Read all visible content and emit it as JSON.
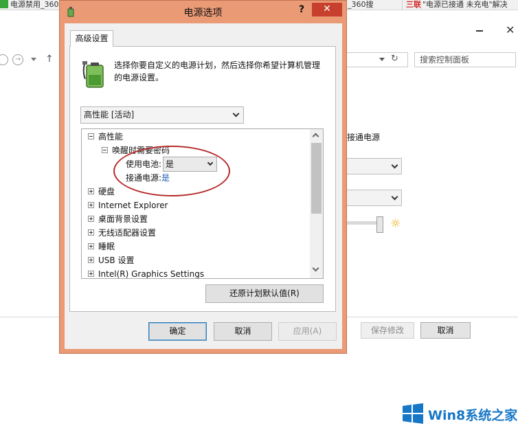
{
  "background": {
    "tabs": [
      {
        "label": "电源禁用_360"
      },
      {
        "label": "_360搜"
      },
      {
        "brand": "三联",
        "label": "\"电源已接通 未充电\"解决"
      }
    ],
    "search_placeholder": "搜索控制面板",
    "plugged_in_label": "接通电源",
    "save_button": "保存修改",
    "cancel_button": "取消"
  },
  "dialog": {
    "title": "电源选项",
    "help": "?",
    "close": "✕",
    "tab": "高级设置",
    "description": "选择你要自定义的电源计划，然后选择你希望计算机管理的电源设置。",
    "plan_selected": "高性能 [活动]",
    "tree": {
      "root": "高性能",
      "sub": "唤醒时需要密码",
      "battery_label": "使用电池:",
      "battery_value": "是",
      "ac_label": "接通电源:",
      "ac_value": "是",
      "items": [
        "硬盘",
        "Internet Explorer",
        "桌面背景设置",
        "无线适配器设置",
        "睡眠",
        "USB 设置",
        "Intel(R) Graphics Settings"
      ]
    },
    "restore_button": "还原计划默认值(R)",
    "ok_button": "确定",
    "cancel_button": "取消",
    "apply_button": "应用(A)"
  },
  "watermark": {
    "text": "Win8系统之家"
  },
  "colors": {
    "dialog_border": "#eb9a76",
    "close_red": "#c7402e",
    "annotation_red": "#b52828",
    "link_blue": "#1a5fb4",
    "watermark_blue": "#1677c7"
  }
}
